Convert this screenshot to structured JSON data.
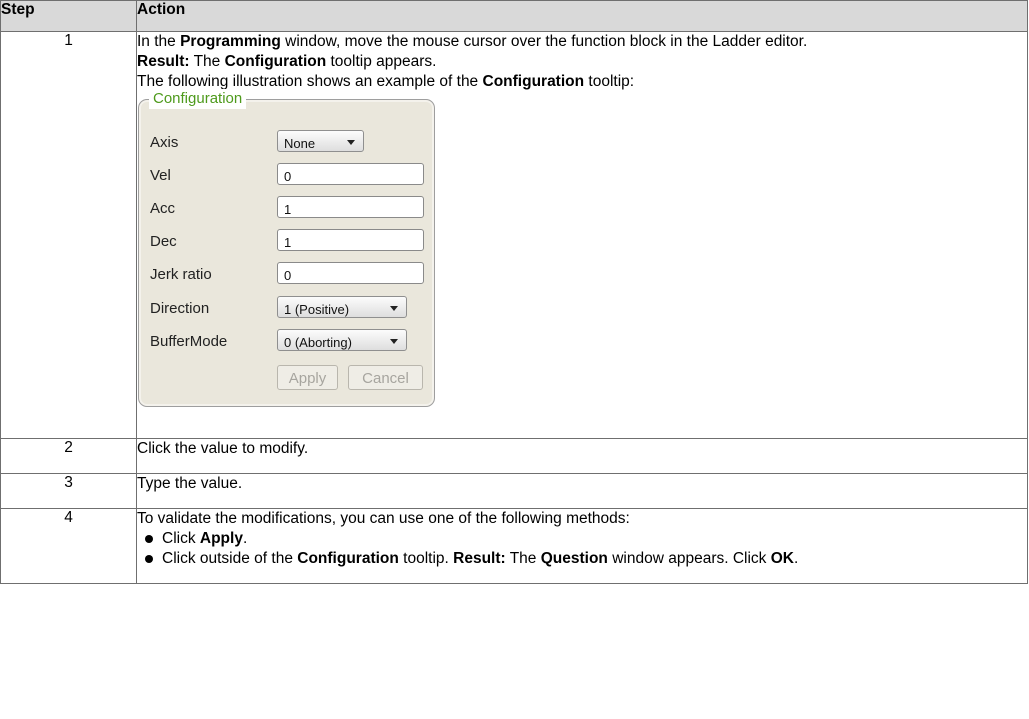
{
  "header": {
    "step": "Step",
    "action": "Action"
  },
  "rows": [
    {
      "step": "1",
      "line1": {
        "t1": "In the ",
        "b1": "Programming",
        "t2": " window, move the mouse cursor over the function block in the Ladder editor."
      },
      "line2": {
        "b1": "Result:",
        "t1": " The ",
        "b2": "Configuration",
        "t2": " tooltip appears."
      },
      "line3": {
        "t1": "The following illustration shows an example of the ",
        "b1": "Configuration",
        "t2": " tooltip:"
      }
    },
    {
      "step": "2",
      "text": "Click the value to modify."
    },
    {
      "step": "3",
      "text": "Type the value."
    },
    {
      "step": "4",
      "intro": "To validate the modifications, you can use one of the following methods:",
      "method1": {
        "t1": "Click ",
        "b1": "Apply",
        "t2": "."
      },
      "method2": {
        "t1": "Click outside of the ",
        "b1": "Configuration",
        "t2": " tooltip. ",
        "b2": "Result:",
        "t3": " The ",
        "b3": "Question",
        "t4": " window appears. Click ",
        "b4": "OK",
        "t5": "."
      }
    }
  ],
  "tooltip": {
    "title": "Configuration",
    "fields": [
      {
        "label": "Axis",
        "value": "None",
        "kind": "combo"
      },
      {
        "label": "Vel",
        "value": "0",
        "kind": "text"
      },
      {
        "label": "Acc",
        "value": "1",
        "kind": "text"
      },
      {
        "label": "Dec",
        "value": "1",
        "kind": "text"
      },
      {
        "label": "Jerk ratio",
        "value": "0",
        "kind": "text"
      },
      {
        "label": "Direction",
        "value": "1 (Positive)",
        "kind": "combo"
      },
      {
        "label": "BufferMode",
        "value": "0 (Aborting)",
        "kind": "combo"
      }
    ],
    "apply_label": "Apply",
    "cancel_label": "Cancel",
    "title_color": "#4e9a1c",
    "panel_color": "#eae7dc"
  }
}
